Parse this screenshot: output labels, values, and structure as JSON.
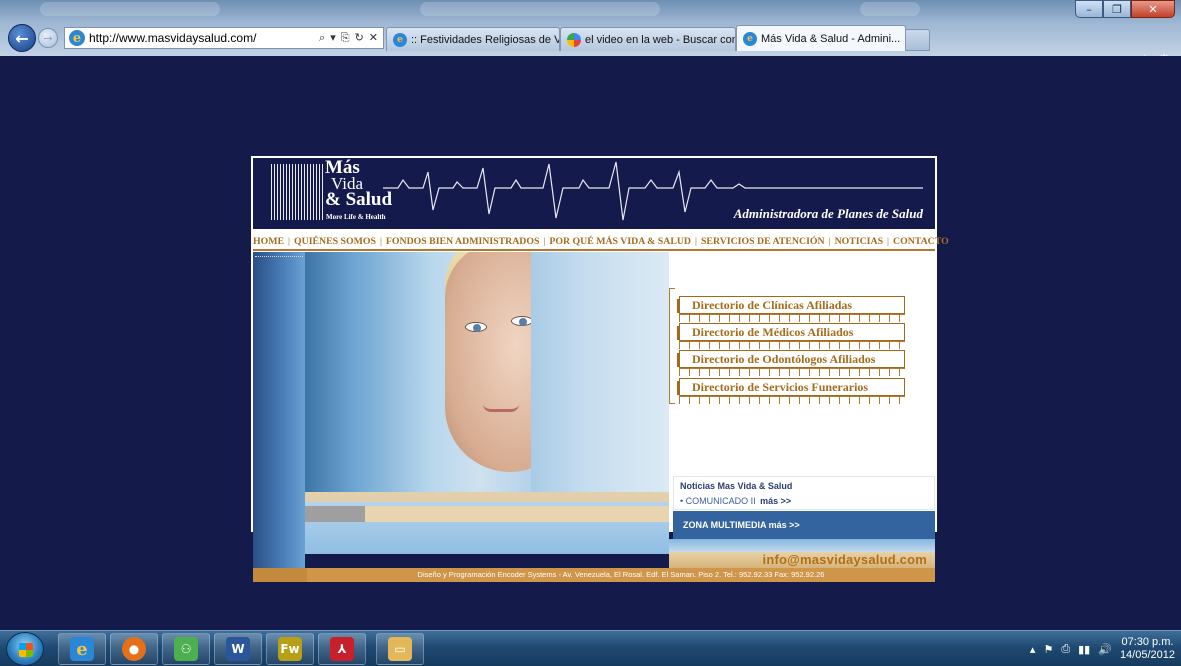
{
  "browser": {
    "url": "http://www.masvidaysalud.com/",
    "addr_tools": [
      "⌕",
      "▾",
      "⎘",
      "↻",
      "✕"
    ],
    "tabs": [
      {
        "label": ":: Festividades Religiosas de Ve...",
        "icon": "ie-icon",
        "active": false
      },
      {
        "label": "el video en la web - Buscar con...",
        "icon": "google-icon",
        "active": false
      },
      {
        "label": "Más Vida & Salud - Admini...",
        "icon": "ie-icon",
        "active": true,
        "close": "✕"
      }
    ],
    "window_buttons": {
      "minimize": "–",
      "maximize": "❐",
      "close": "✕"
    },
    "toolbar_icons": {
      "home": "⌂",
      "favorites": "☆",
      "tools": "⚙"
    }
  },
  "site": {
    "logo": {
      "line1": "Más",
      "line2": "Vida",
      "line3": "& Salud",
      "tagline": "More Life & Health"
    },
    "header_tagline": "Administradora de Planes de Salud",
    "nav": [
      "HOME",
      "QUIÉNES SOMOS",
      "FONDOS BIEN ADMINISTRADOS",
      "POR QUÉ MÁS VIDA & SALUD",
      "SERVICIOS DE ATENCIÓN",
      "NOTICIAS",
      "CONTACTO"
    ],
    "nav_separator": "|",
    "directories": [
      "Directorio de Clínicas Afiliadas",
      "Directorio de Médicos Afiliados",
      "Directorio de Odontólogos Afiliados",
      "Directorio de Servicios Funerarios"
    ],
    "news": {
      "title": "Noticias Mas Vida & Salud",
      "item": "• COMUNICADO II",
      "more": "más >>"
    },
    "multimedia": "ZONA MULTIMEDIA más >>",
    "email": "info@masvidaysalud.com",
    "footer": "Diseño y Programación Encoder Systems - Av. Venezuela, El Rosal. Edf. El Saman. Piso 2. Tel.: 952.92.33 Fax: 952.92.26"
  },
  "taskbar": {
    "apps": [
      {
        "name": "internet-explorer",
        "glyph": "e",
        "color": "#2a86d6"
      },
      {
        "name": "firefox",
        "glyph": "●",
        "color": "#e66f1a"
      },
      {
        "name": "messenger",
        "glyph": "⚇",
        "color": "#4caf50"
      },
      {
        "name": "word",
        "glyph": "W",
        "color": "#2b579a"
      },
      {
        "name": "fireworks",
        "glyph": "Fw",
        "color": "#b5a018"
      },
      {
        "name": "acrobat",
        "glyph": "⅄",
        "color": "#c8202b"
      },
      {
        "name": "explorer",
        "glyph": "▭",
        "color": "#e3b85a"
      }
    ],
    "tray_icons": [
      "▴",
      "⚑",
      "⎙",
      "▮▮",
      "🔊"
    ],
    "time": "07:30 p.m.",
    "date": "14/05/2012"
  },
  "colors": {
    "page_bg": "#141a4a",
    "accent_gold": "#a56d1e",
    "header_navy": "#151a4d",
    "multimedia_blue": "#33649f"
  }
}
